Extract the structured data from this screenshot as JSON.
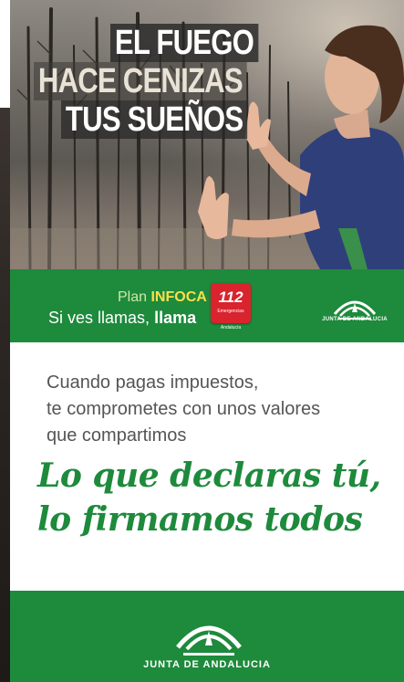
{
  "banner_top": {
    "headline": [
      "EL FUEGO",
      "HACE CENIZAS",
      "TUS SUEÑOS"
    ],
    "plan_prefix": "Plan",
    "plan_name": "INFOCA",
    "tagline_pre": "Si ves llamas,",
    "tagline_bold": "llama",
    "badge_number": "112",
    "badge_sub": "Emergencias",
    "badge_region": "Andalucía",
    "logo_text": "JUNTA DE ANDALUCIA"
  },
  "banner_bottom": {
    "body_lines": [
      "Cuando pagas impuestos,",
      "te comprometes con unos valores",
      "que compartimos"
    ],
    "slogan_lines": [
      "Lo que declaras tú,",
      "lo firmamos todos"
    ],
    "logo_text": "JUNTA DE ANDALUCIA"
  },
  "colors": {
    "brand_green": "#1e8a3c",
    "plan_yellow": "#f7e04b",
    "emergency_red": "#d9232d"
  },
  "icons": [
    "junta-de-andalucia-logo",
    "emergency-112-badge"
  ]
}
